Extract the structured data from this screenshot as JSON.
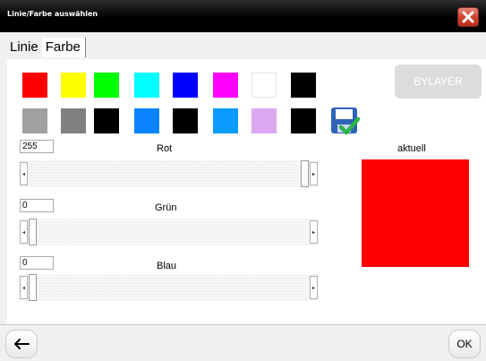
{
  "dialog": {
    "title": "Linie/Farbe auswählen",
    "close_icon": "close-icon"
  },
  "tabs": [
    {
      "label": "Linie",
      "active": false
    },
    {
      "label": "Farbe",
      "active": true
    }
  ],
  "palette": {
    "row1": [
      "#ff0000",
      "#ffff00",
      "#00ff00",
      "#00ffff",
      "#0000ff",
      "#ff00ff",
      "#ffffff",
      "#000000"
    ],
    "row2": [
      "#a0a0a0",
      "#808080",
      "#000000",
      "#0a84ff",
      "#000000",
      "#0a9bff",
      "#dca8f0",
      "#000000"
    ]
  },
  "bylayer_label": "BYLAYER",
  "save_icon": "save-check-icon",
  "channels": {
    "red": {
      "label": "Rot",
      "value": "255",
      "level": 1.0
    },
    "green": {
      "label": "Grün",
      "value": "0",
      "level": 0.0
    },
    "blue": {
      "label": "Blau",
      "value": "0",
      "level": 0.0
    }
  },
  "current": {
    "label": "aktuell",
    "color": "#ff0000"
  },
  "footer": {
    "back_icon": "arrow-left-icon",
    "ok_label": "OK"
  }
}
